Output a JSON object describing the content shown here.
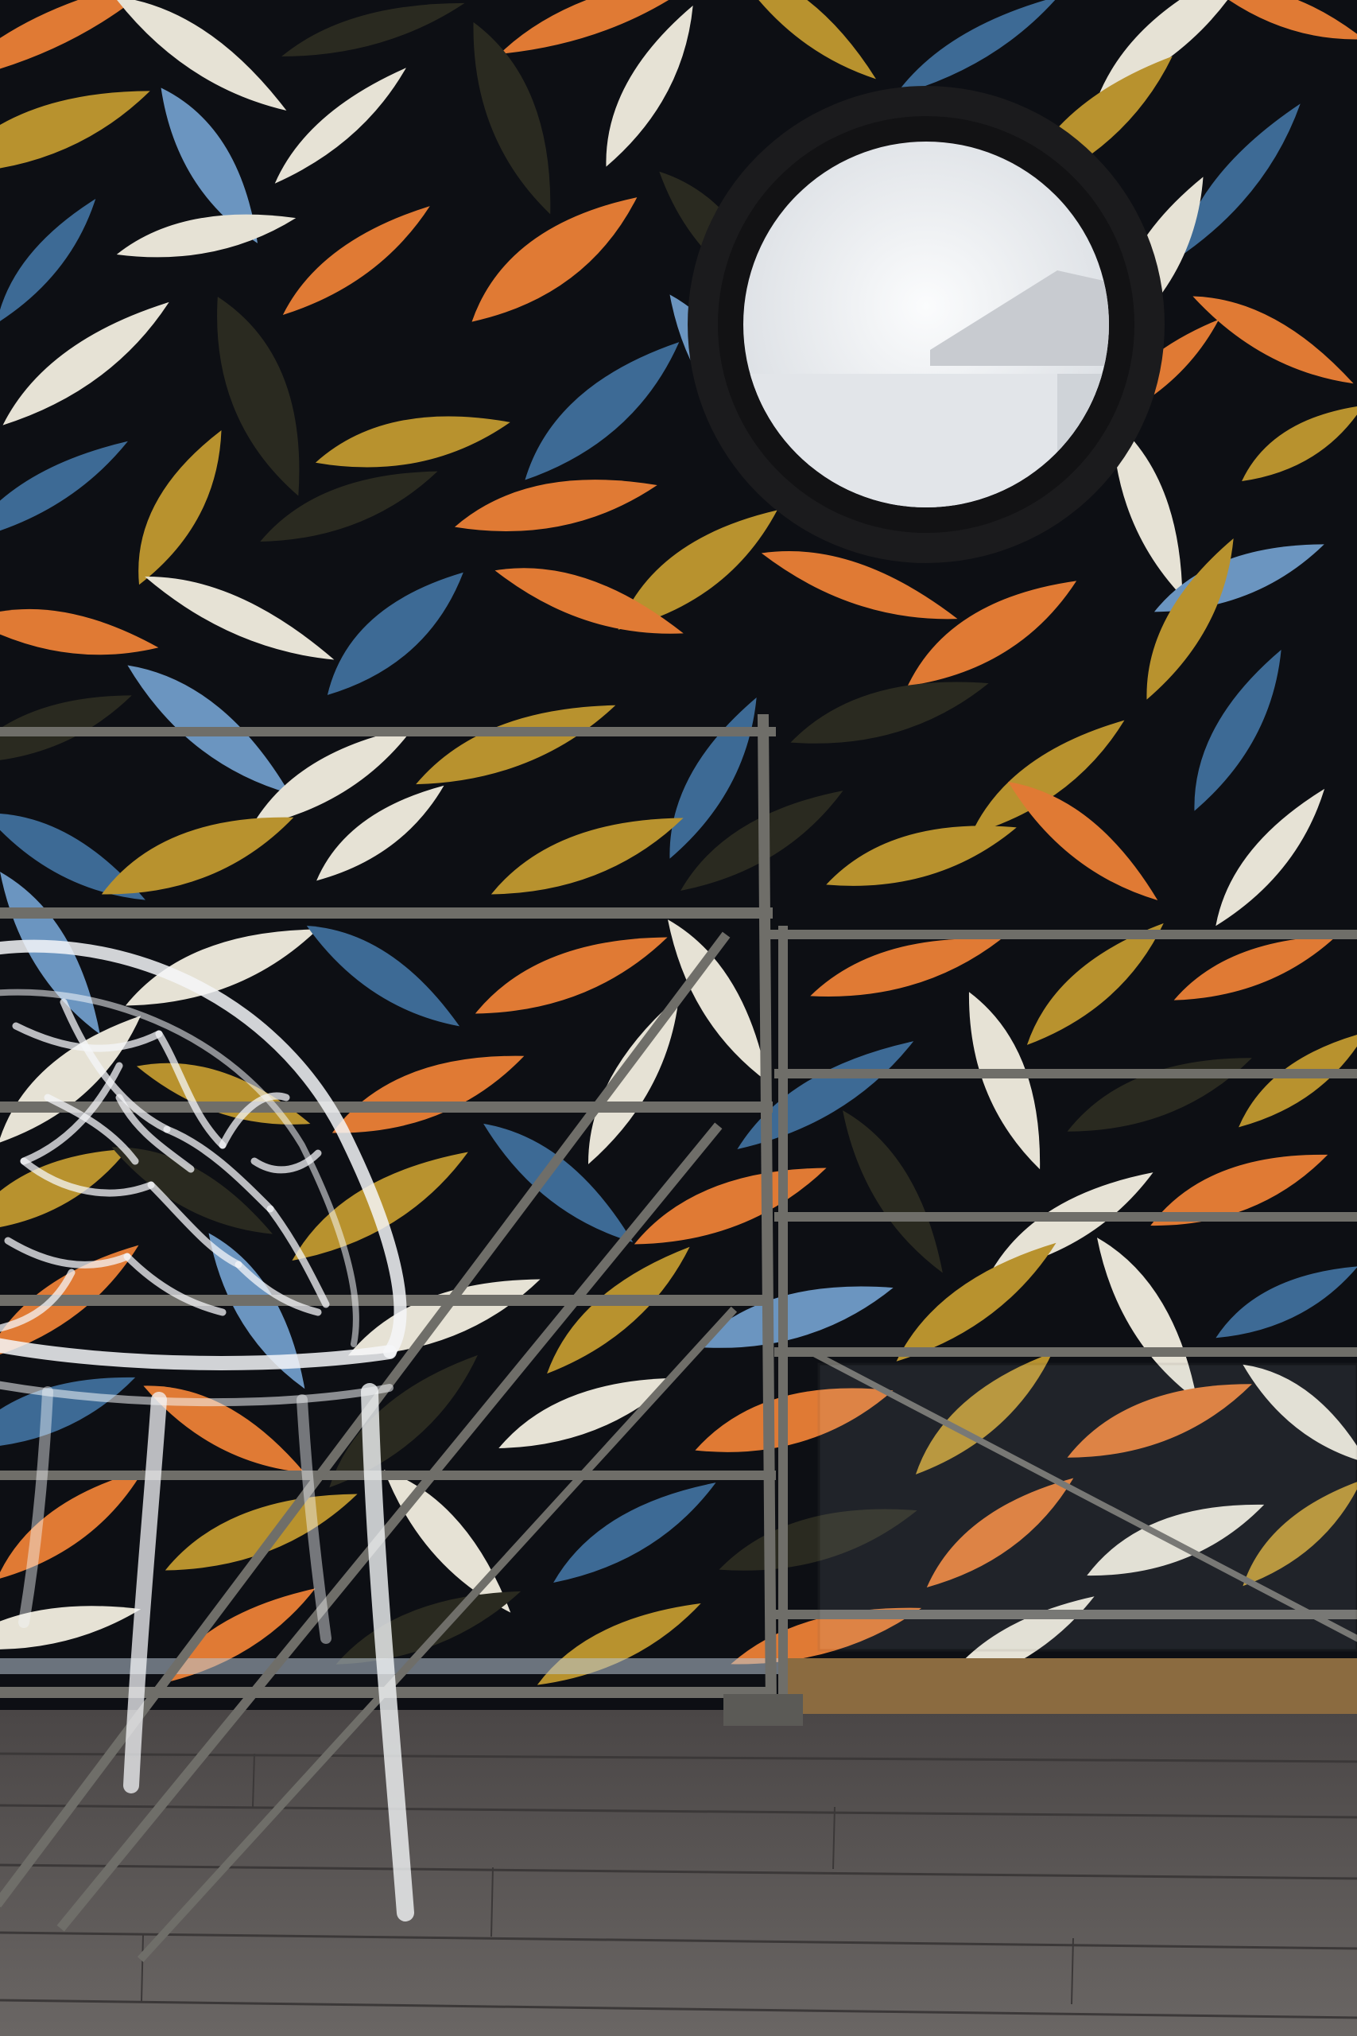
{
  "scene": {
    "subject": "interior-wall-with-porthole-window",
    "elements": [
      "leaf-pattern-wallpaper",
      "round-porthole-window",
      "metal-stair-railing",
      "transparent-branch-chair",
      "wooden-floor"
    ]
  },
  "palette": {
    "wall_background": "#0d0f14",
    "leaf_orange": "#e07a34",
    "leaf_mustard": "#b8922e",
    "leaf_blue": "#3d6a95",
    "leaf_light_blue": "#6b95c0",
    "leaf_cream": "#e6e2d5",
    "leaf_olive_dark": "#2a2a20",
    "railing_gray": "#6f6e69",
    "window_frame": "#1b1b1d",
    "window_glass": "#eef0f2",
    "floor_wood": "#5a5655",
    "chair_clear": "#f4f6f8"
  }
}
